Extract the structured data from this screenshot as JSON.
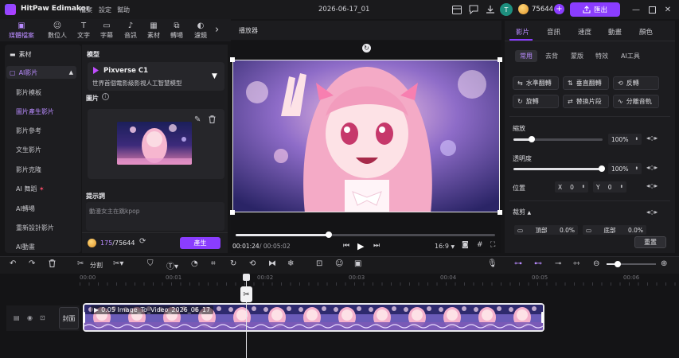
{
  "app": {
    "title": "HitPaw Edimakor",
    "menu": [
      "檔案",
      "設定",
      "幫助"
    ],
    "document_title": "2026-06-17_01",
    "avatar_letter": "T",
    "credits": "75644",
    "export_label": "匯出"
  },
  "tool_tabs": [
    {
      "label": "媒體檔案",
      "icon": "media-icon"
    },
    {
      "label": "數位人",
      "icon": "avatar-person-icon"
    },
    {
      "label": "文字",
      "icon": "text-icon"
    },
    {
      "label": "字幕",
      "icon": "subtitle-icon"
    },
    {
      "label": "音訊",
      "icon": "music-icon"
    },
    {
      "label": "素材",
      "icon": "assets-icon"
    },
    {
      "label": "轉場",
      "icon": "transition-icon"
    },
    {
      "label": "濾鏡",
      "icon": "filter-icon"
    }
  ],
  "left_nav": {
    "assets_label": "素材",
    "ai_label": "AI影片",
    "items": [
      "影片模板",
      "圖片產生影片",
      "影片參考",
      "文生影片",
      "影片克隆",
      "AI 舞蹈",
      "AI轉場",
      "重新設計影片",
      "AI動畫"
    ]
  },
  "generator": {
    "model_section": "模型",
    "model_name": "Pixverse C1",
    "model_desc": "世界首個電影級影視人工智慧模型",
    "image_section": "圖片",
    "prompt_section": "提示詞",
    "prompt_placeholder": "動漫女主在跳kpop",
    "cost": "175",
    "credits_total": "/75644",
    "generate_label": "產生"
  },
  "player": {
    "title": "播放器",
    "current_time": "00:01:24",
    "total_time": "/ 00:05:02",
    "aspect_ratio": "16:9",
    "progress": 0.28
  },
  "properties": {
    "tabs": [
      "影片",
      "音訊",
      "速度",
      "動畫",
      "顏色"
    ],
    "subtabs": [
      "常用",
      "去背",
      "蒙版",
      "特效",
      "AI工具"
    ],
    "buttons": [
      "水準翻轉",
      "垂直翻轉",
      "反轉",
      "旋轉",
      "替換片段",
      "分離音軌"
    ],
    "scale_label": "縮放",
    "scale_value": "100%",
    "opacity_label": "透明度",
    "opacity_value": "100%",
    "position_label": "位置",
    "pos_x_label": "X",
    "pos_x": "0",
    "pos_y_label": "Y",
    "pos_y": "0",
    "crop_label": "裁剪",
    "crop_top_label": "頂部",
    "crop_top": "0.0%",
    "crop_bottom_label": "底部",
    "crop_bottom": "0.0%",
    "reset_label": "重置"
  },
  "timeline": {
    "split_label": "分割",
    "ticks": [
      "00:00",
      "00:01",
      "00:02",
      "00:03",
      "00:04",
      "00:05",
      "00:06"
    ],
    "cover_label": "封面",
    "clip_name": "0.05 Image_To_Video_2026_06_17"
  },
  "colors": {
    "accent": "#8a3dff",
    "accent_text": "#b98bff",
    "panel": "#1d1d20",
    "background": "#151517"
  }
}
